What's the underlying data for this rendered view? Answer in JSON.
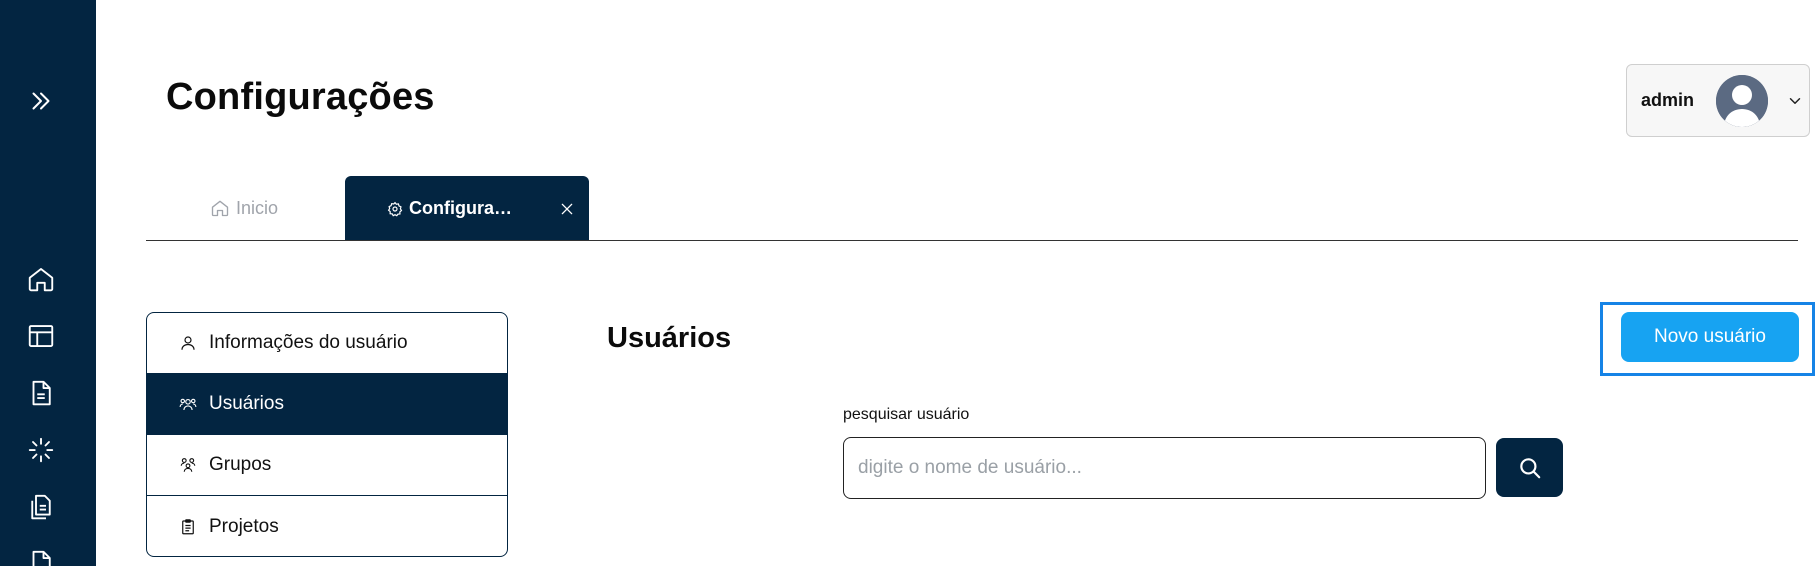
{
  "header": {
    "title": "Configurações",
    "user_name": "admin"
  },
  "tabs": [
    {
      "label": "Inicio",
      "icon": "home-icon"
    },
    {
      "label": "Configurações",
      "icon": "gear-icon"
    }
  ],
  "settings_menu": {
    "items": [
      {
        "label": "Informações do usuário",
        "icon": "user-icon"
      },
      {
        "label": "Usuários",
        "icon": "users-icon"
      },
      {
        "label": "Grupos",
        "icon": "group-icon"
      },
      {
        "label": "Projetos",
        "icon": "clipboard-icon"
      }
    ],
    "selected": "Usuários"
  },
  "main": {
    "section_title": "Usuários",
    "new_user_button": "Novo usuário",
    "search_label": "pesquisar usuário",
    "search_placeholder": "digite o nome de usuário..."
  },
  "colors": {
    "navy": "#032541",
    "accent": "#17a3f2",
    "focus": "#1583e6"
  }
}
